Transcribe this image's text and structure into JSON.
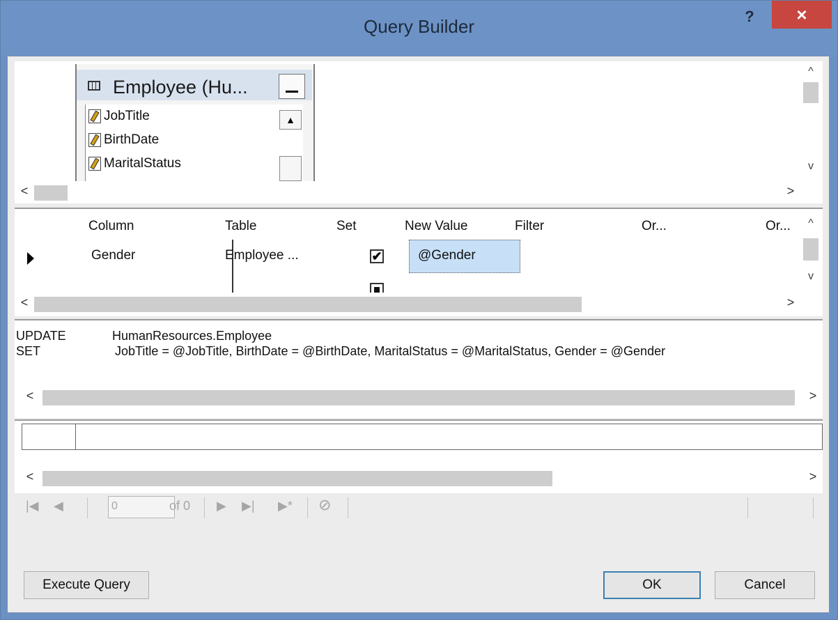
{
  "window": {
    "title": "Query Builder",
    "help_label": "?",
    "close_label": "×"
  },
  "diagram": {
    "table_name": "Employee (Hu...",
    "minimize_label": "_",
    "scroll_up_label": "▲",
    "fields": [
      "JobTitle",
      "BirthDate",
      "MaritalStatus"
    ]
  },
  "grid": {
    "columns": [
      "Column",
      "Table",
      "Set",
      "New Value",
      "Filter",
      "Or...",
      "Or..."
    ],
    "row": {
      "column": "Gender",
      "table": "Employee ...",
      "set_checked": true,
      "set_mark": "✔",
      "new_value": "@Gender"
    }
  },
  "sql": {
    "update_kw": "UPDATE",
    "update_target": "HumanResources.Employee",
    "set_kw": "SET",
    "set_clause": "JobTitle = @JobTitle, BirthDate = @BirthDate, MaritalStatus = @MaritalStatus, Gender = @Gender"
  },
  "navigator": {
    "first": "|◀",
    "prev": "◀",
    "position_value": "0",
    "of_label": "of 0",
    "next": "▶",
    "last": "▶|",
    "new": "▶*",
    "cancel": "⊘"
  },
  "scroll": {
    "left": "<",
    "right": ">",
    "up": "^",
    "down": "v"
  },
  "buttons": {
    "execute": "Execute Query",
    "ok": "OK",
    "cancel": "Cancel"
  },
  "colors": {
    "titlebar": "#6d92c6",
    "close": "#c7463f",
    "selected_cell": "#c7e0f8"
  }
}
